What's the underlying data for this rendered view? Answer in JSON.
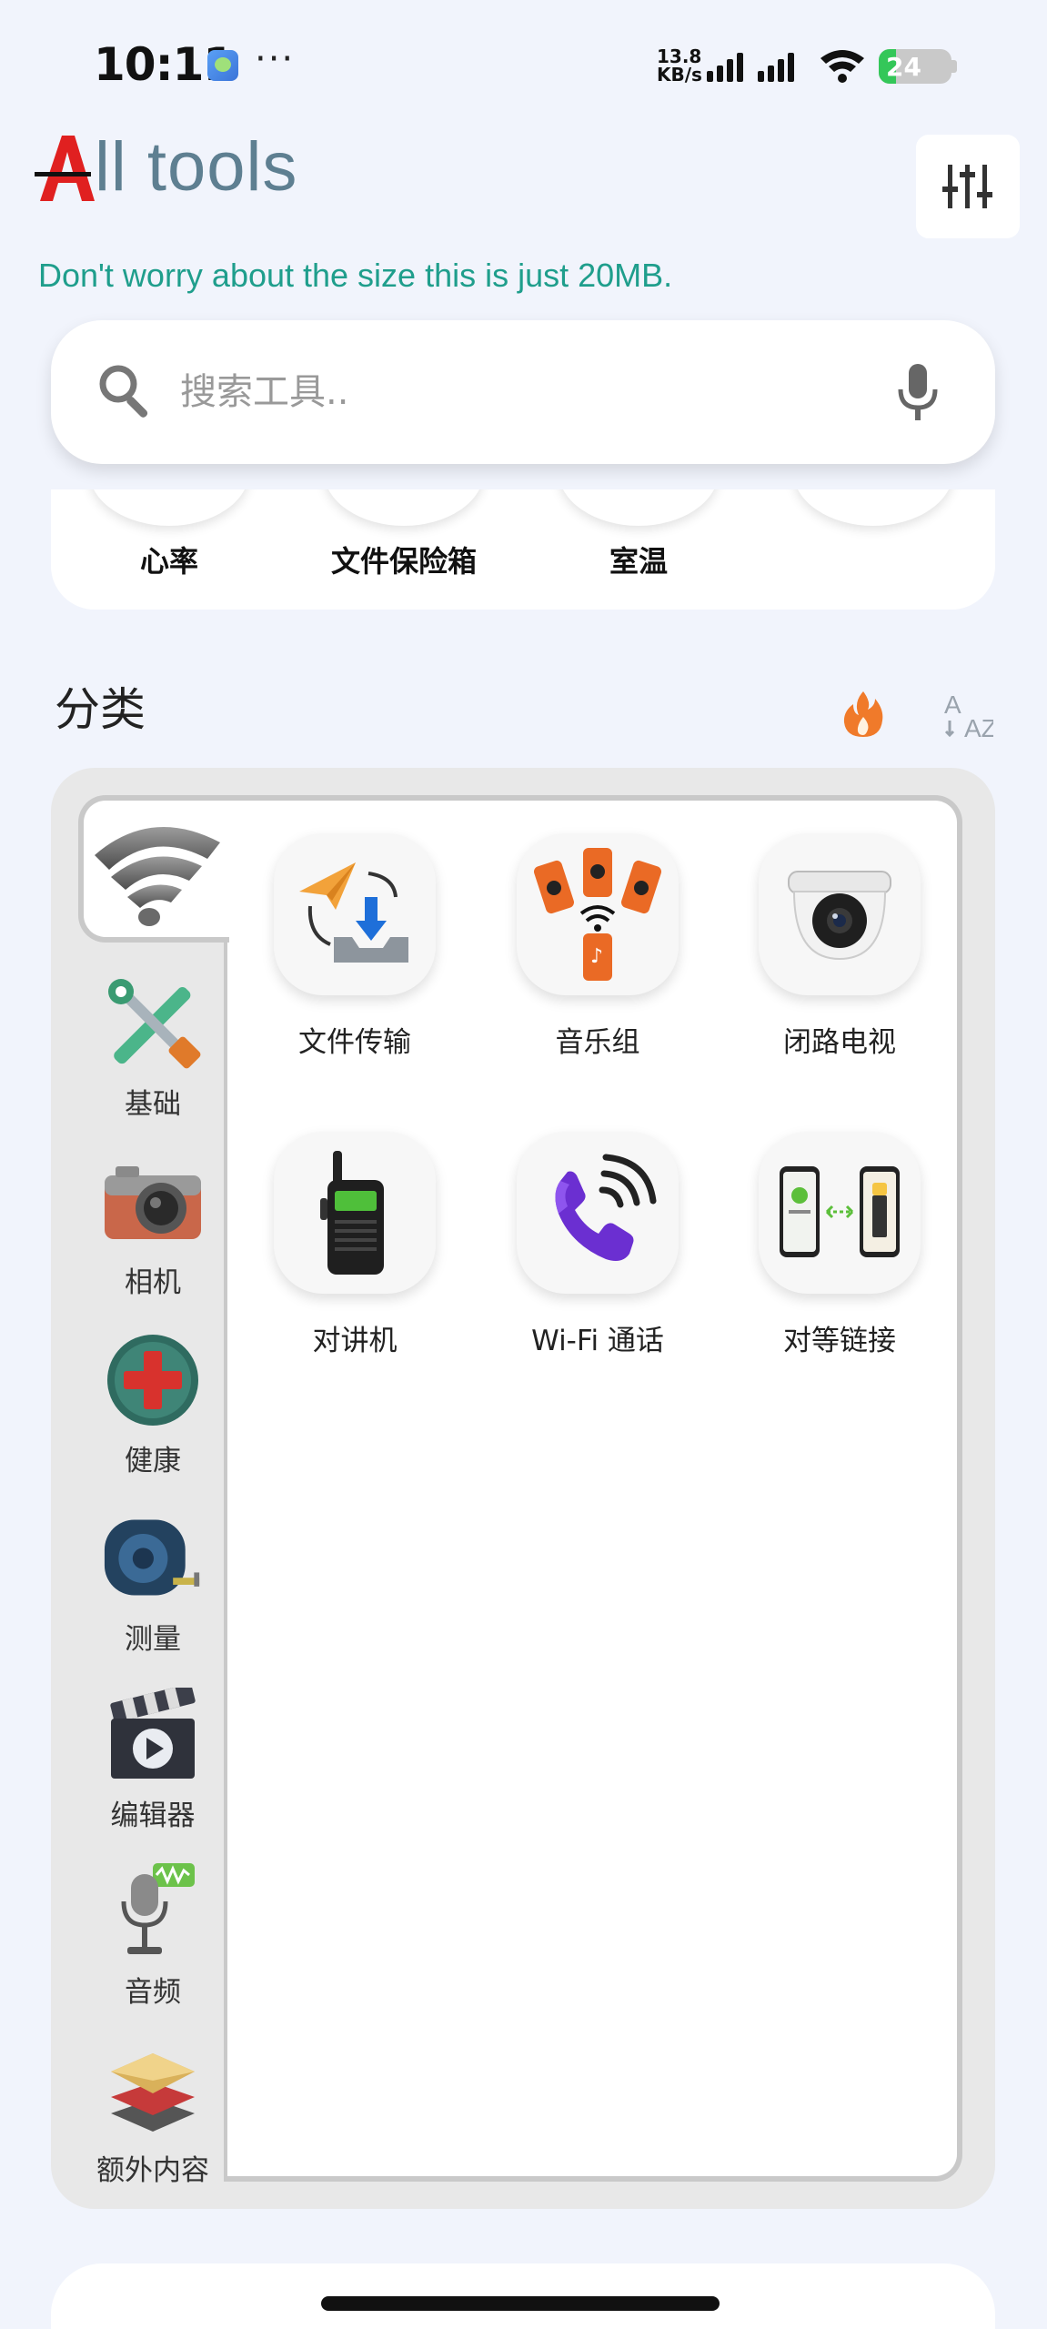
{
  "status_bar": {
    "time": "10:11",
    "speed_value": "13.8",
    "speed_unit": "KB/s",
    "battery": "24",
    "battery_level_percent": 24,
    "more_icon": "more-dots-icon"
  },
  "header": {
    "title": "ll tools",
    "logo_letter": "A",
    "tagline": "Don't worry about the size this is just 20MB.",
    "filter_icon": "sliders-icon"
  },
  "search": {
    "placeholder": "搜索工具.."
  },
  "recent": {
    "items": [
      {
        "label": "心率"
      },
      {
        "label": "文件保险箱"
      },
      {
        "label": "室温"
      },
      {
        "label": ""
      }
    ]
  },
  "categories": {
    "title": "分类",
    "sort_hot_icon": "flame-icon",
    "sort_az_label": "AZ",
    "items": [
      {
        "label": "",
        "icon": "wifi-icon",
        "selected": true
      },
      {
        "label": "基础",
        "icon": "tools-icon"
      },
      {
        "label": "相机",
        "icon": "camera-icon"
      },
      {
        "label": "健康",
        "icon": "health-cross-icon"
      },
      {
        "label": "测量",
        "icon": "tape-measure-icon"
      },
      {
        "label": "编辑器",
        "icon": "clapperboard-icon"
      },
      {
        "label": "音频",
        "icon": "microphone-icon"
      },
      {
        "label": "额外内容",
        "icon": "layers-icon"
      }
    ]
  },
  "tools": [
    {
      "label": "文件传输",
      "icon": "file-transfer-icon"
    },
    {
      "label": "音乐组",
      "icon": "music-group-icon"
    },
    {
      "label": "闭路电视",
      "icon": "cctv-camera-icon"
    },
    {
      "label": "对讲机",
      "icon": "walkie-talkie-icon"
    },
    {
      "label": "Wi-Fi 通话",
      "icon": "wifi-call-icon"
    },
    {
      "label": "对等链接",
      "icon": "peer-link-icon"
    }
  ],
  "colors": {
    "background": "#F1F4FC",
    "title": "#5e7f91",
    "tagline": "#1f9e8c",
    "logo_red": "#e02020",
    "hot": "#f07a2a",
    "battery": "#34c759"
  }
}
